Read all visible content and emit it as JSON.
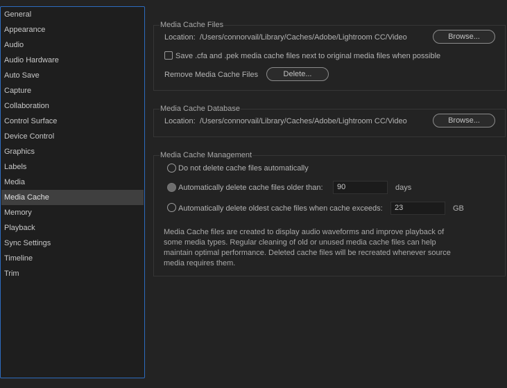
{
  "sidebar": {
    "items": [
      {
        "label": "General"
      },
      {
        "label": "Appearance"
      },
      {
        "label": "Audio"
      },
      {
        "label": "Audio Hardware"
      },
      {
        "label": "Auto Save"
      },
      {
        "label": "Capture"
      },
      {
        "label": "Collaboration"
      },
      {
        "label": "Control Surface"
      },
      {
        "label": "Device Control"
      },
      {
        "label": "Graphics"
      },
      {
        "label": "Labels"
      },
      {
        "label": "Media"
      },
      {
        "label": "Media Cache"
      },
      {
        "label": "Memory"
      },
      {
        "label": "Playback"
      },
      {
        "label": "Sync Settings"
      },
      {
        "label": "Timeline"
      },
      {
        "label": "Trim"
      }
    ],
    "selected_label": "Media Cache"
  },
  "media_cache_files": {
    "title": "Media Cache Files",
    "location_label": "Location:",
    "location_path": "/Users/connorvail/Library/Caches/Adobe/Lightroom CC/Video",
    "browse_label": "Browse...",
    "save_checkbox_label": "Save .cfa and .pek media cache files next to original media files when possible",
    "save_checked": false,
    "remove_label": "Remove Media Cache Files",
    "delete_label": "Delete..."
  },
  "media_cache_database": {
    "title": "Media Cache Database",
    "location_label": "Location:",
    "location_path": "/Users/connorvail/Library/Caches/Adobe/Lightroom CC/Video",
    "browse_label": "Browse..."
  },
  "media_cache_management": {
    "title": "Media Cache Management",
    "option_no_delete": "Do not delete cache files automatically",
    "option_older_than": "Automatically delete cache files older than:",
    "older_than_value": "90",
    "older_than_unit": "days",
    "option_exceeds": "Automatically delete oldest cache files when cache exceeds:",
    "exceeds_value": "23",
    "exceeds_unit": "GB",
    "description": "Media Cache files are created to display audio waveforms and improve playback of some media types.  Regular cleaning of old or unused media cache files can help maintain optimal performance. Deleted cache files will be recreated whenever source media requires them."
  }
}
